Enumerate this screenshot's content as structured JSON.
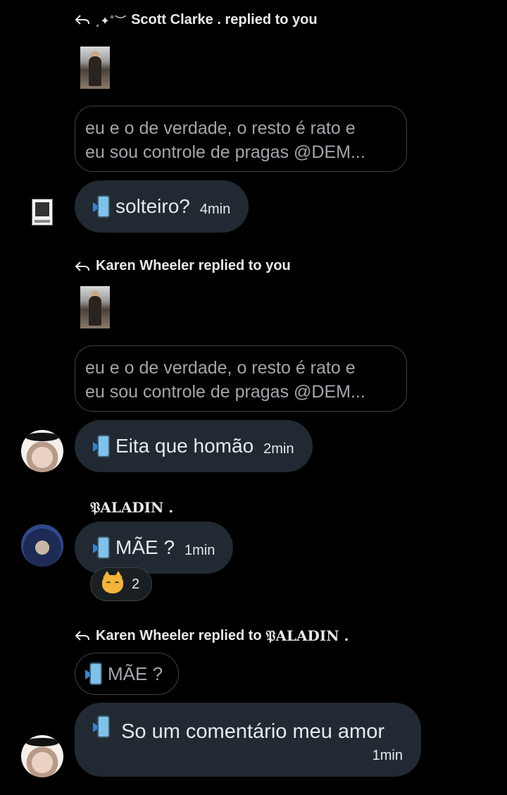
{
  "thread1": {
    "sparkle": "˳✦˚︶",
    "author": "Scott Clarke .",
    "suffix": "replied to you",
    "quote_line1": "eu e o de verdade, o resto é rato e",
    "quote_line2": "eu sou controle de pragas @DEM...",
    "message": "solteiro?",
    "time": "4min"
  },
  "thread2": {
    "author": "Karen Wheeler",
    "suffix": "replied to you",
    "quote_line1": "eu e o de verdade, o resto é rato e",
    "quote_line2": "eu sou controle de pragas @DEM...",
    "message": "Eita que homão",
    "time": "2min"
  },
  "thread3": {
    "name": "𝔓ALADIN .",
    "message": "MÃE ?",
    "time": "1min",
    "reaction_emoji": "crying-cat",
    "reaction_count": "2"
  },
  "thread4": {
    "author": "Karen Wheeler",
    "suffix": "replied to",
    "target": "𝔓ALADIN .",
    "quote": "MÃE ?",
    "message": "So um comentário meu amor",
    "time": "1min"
  },
  "icons": {
    "reply": "reply-arrow-icon",
    "message_prefix": "phone-arrow-emoji"
  },
  "colors": {
    "background": "#000000",
    "bubble": "#212a32",
    "quote_border": "#3e4144",
    "quote_text": "#a1a6ab"
  }
}
